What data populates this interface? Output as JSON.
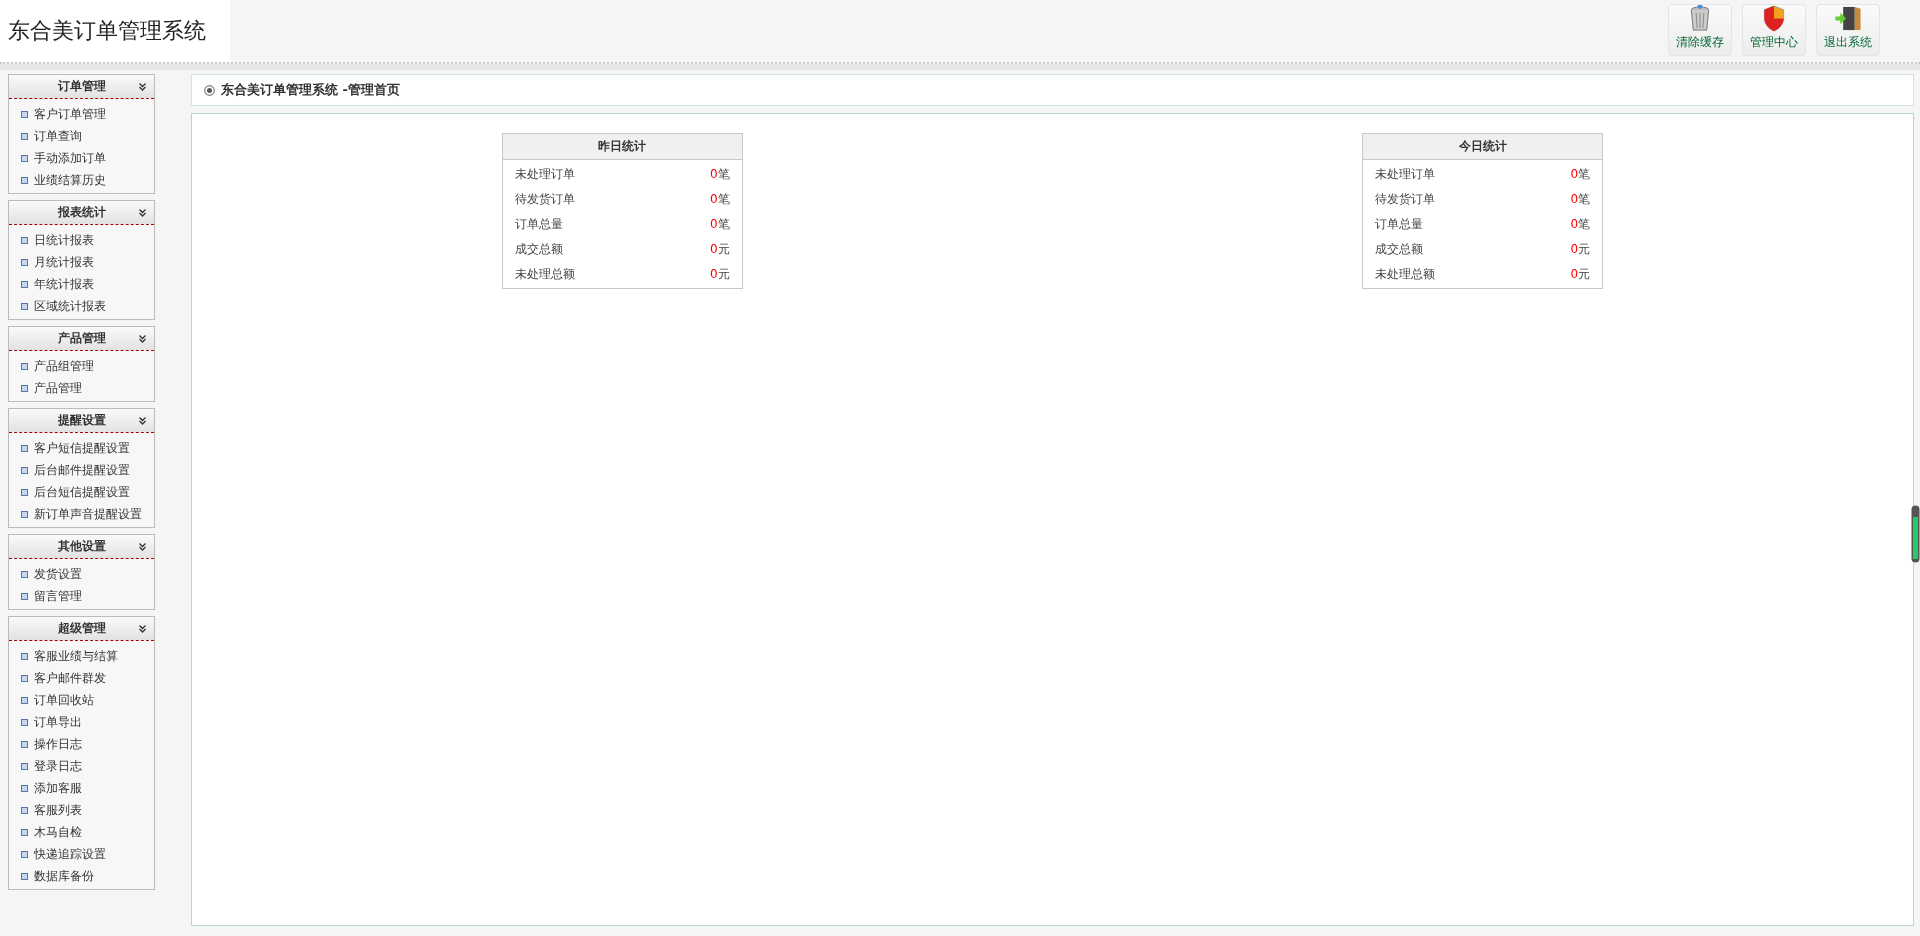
{
  "header": {
    "title": "东合美订单管理系统",
    "buttons": [
      {
        "kind": "trash",
        "label": "清除缓存"
      },
      {
        "kind": "shield",
        "label": "管理中心"
      },
      {
        "kind": "exit",
        "label": "退出系统"
      }
    ]
  },
  "sidebar": {
    "groups": [
      {
        "title": "订单管理",
        "items": [
          "客户订单管理",
          "订单查询",
          "手动添加订单",
          "业绩结算历史"
        ]
      },
      {
        "title": "报表统计",
        "items": [
          "日统计报表",
          "月统计报表",
          "年统计报表",
          "区域统计报表"
        ]
      },
      {
        "title": "产品管理",
        "items": [
          "产品组管理",
          "产品管理"
        ]
      },
      {
        "title": "提醒设置",
        "items": [
          "客户短信提醒设置",
          "后台邮件提醒设置",
          "后台短信提醒设置",
          "新订单声音提醒设置"
        ]
      },
      {
        "title": "其他设置",
        "items": [
          "发货设置",
          "留言管理"
        ]
      },
      {
        "title": "超级管理",
        "items": [
          "客服业绩与结算",
          "客户邮件群发",
          "订单回收站",
          "订单导出",
          "操作日志",
          "登录日志",
          "添加客服",
          "客服列表",
          "木马自检",
          "快递追踪设置",
          "数据库备份"
        ]
      }
    ]
  },
  "breadcrumb": "东合美订单管理系统 -管理首页",
  "stats": [
    {
      "title": "昨日统计",
      "rows": [
        {
          "label": "未处理订单",
          "value": "0",
          "unit": "笔"
        },
        {
          "label": "待发货订单",
          "value": "0",
          "unit": "笔"
        },
        {
          "label": "订单总量",
          "value": "0",
          "unit": "笔"
        },
        {
          "label": "成交总额",
          "value": "0",
          "unit": "元"
        },
        {
          "label": "未处理总额",
          "value": "0",
          "unit": "元"
        }
      ]
    },
    {
      "title": "今日统计",
      "rows": [
        {
          "label": "未处理订单",
          "value": "0",
          "unit": "笔"
        },
        {
          "label": "待发货订单",
          "value": "0",
          "unit": "笔"
        },
        {
          "label": "订单总量",
          "value": "0",
          "unit": "笔"
        },
        {
          "label": "成交总额",
          "value": "0",
          "unit": "元"
        },
        {
          "label": "未处理总额",
          "value": "0",
          "unit": "元"
        }
      ]
    }
  ]
}
